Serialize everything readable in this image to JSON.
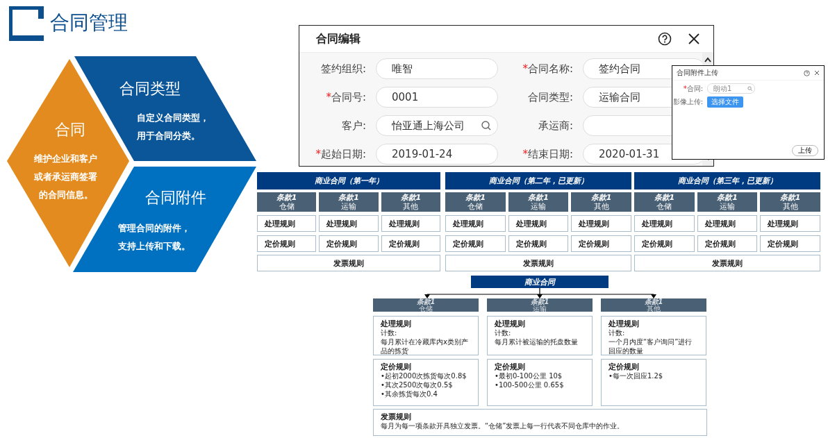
{
  "title": "合同管理",
  "hexagon": {
    "center": {
      "title": "合同",
      "text": "维护企业和客户或者承运商签署的合同信息。"
    },
    "top": {
      "title": "合同类型",
      "text": "自定义合同类型，用于合同分类。"
    },
    "bottom": {
      "title": "合同附件",
      "text": "管理合同的附件，支持上传和下载。"
    }
  },
  "edit_dialog": {
    "title": "合同编辑",
    "fields": [
      {
        "label": "签约组织:",
        "value": "唯智",
        "kind": "text"
      },
      {
        "marker": "*",
        "label": "合同名称:",
        "value": "签约合同",
        "kind": "text"
      },
      {
        "marker": "*",
        "label": "合同号:",
        "value": "0001",
        "kind": "text"
      },
      {
        "label": "合同类型:",
        "value": "运输合同",
        "kind": "text"
      },
      {
        "label": "客户:",
        "value": "怡亚通上海公司",
        "kind": "search"
      },
      {
        "label": "承运商:",
        "kind": "text"
      },
      {
        "marker": "*",
        "label": "起始日期:",
        "value": "2019-01-24",
        "kind": "text"
      },
      {
        "marker": "*",
        "label": "结束日期:",
        "value": "2020-01-31",
        "kind": "text"
      }
    ]
  },
  "upload_dialog": {
    "title": "合同附件上传",
    "contract_marker": "*",
    "contract_label": "合同:",
    "contract_value": "朗动1",
    "file_label": "影像上传:",
    "file_button": "选择文件",
    "submit": "上传"
  },
  "contracts": [
    {
      "title": "商业合同（第一年）",
      "clauses": [
        {
          "name": "条款1",
          "type": "仓储",
          "rules": [
            "处理规则",
            "定价规则"
          ]
        },
        {
          "name": "条款1",
          "type": "运输",
          "rules": [
            "处理规则",
            "定价规则"
          ]
        },
        {
          "name": "条款1",
          "type": "其他",
          "rules": [
            "处理规则",
            "定价规则"
          ]
        }
      ],
      "invoice": "发票规则"
    },
    {
      "title": "商业合同（第二年，已更新）",
      "clauses": [
        {
          "name": "条款1",
          "type": "仓储",
          "rules": [
            "处理规则",
            "定价规则"
          ]
        },
        {
          "name": "条款1",
          "type": "运输",
          "rules": [
            "处理规则",
            "定价规则"
          ]
        },
        {
          "name": "条款1",
          "type": "其他",
          "rules": [
            "处理规则",
            "定价规则"
          ]
        }
      ],
      "invoice": "发票规则"
    },
    {
      "title": "商业合同（第三年，已更新）",
      "clauses": [
        {
          "name": "条款1",
          "type": "仓储",
          "rules": [
            "处理规则",
            "定价规则"
          ]
        },
        {
          "name": "条款1",
          "type": "运输",
          "rules": [
            "处理规则",
            "定价规则"
          ]
        },
        {
          "name": "条款1",
          "type": "其他",
          "rules": [
            "处理规则",
            "定价规则"
          ]
        }
      ],
      "invoice": "发票规则"
    }
  ],
  "detail": {
    "title": "商业合同",
    "clauses": [
      {
        "name": "条款1",
        "type": "仓储",
        "processing": {
          "title": "处理规则",
          "lines": [
            "计数:",
            "每月累计在冷藏库内x类别产品的拣货"
          ]
        },
        "pricing": {
          "title": "定价规则",
          "lines": [
            "•起初2000次拣货每次0.8$",
            "•其次2500次每次0.5$",
            "•其余拣货每次0.4"
          ]
        }
      },
      {
        "name": "条款1",
        "type": "运输",
        "processing": {
          "title": "处理规则",
          "lines": [
            "计数:",
            "每月累计被运输的托盘数量"
          ]
        },
        "pricing": {
          "title": "定价规则",
          "lines": [
            "•最初0-100公里 10$",
            "•100-500公里 0.65$"
          ]
        }
      },
      {
        "name": "条款1",
        "type": "其他",
        "processing": {
          "title": "处理规则",
          "lines": [
            "计数:",
            "一个月内度“客户询问”进行回应的数量"
          ]
        },
        "pricing": {
          "title": "定价规则",
          "lines": [
            "•每一次回应1.2$"
          ]
        }
      }
    ],
    "invoice": {
      "title": "发票规则",
      "text": "每月为每一项条款开具独立发票。“仓储”发票上每一行代表不同仓库中的作业。"
    }
  }
}
